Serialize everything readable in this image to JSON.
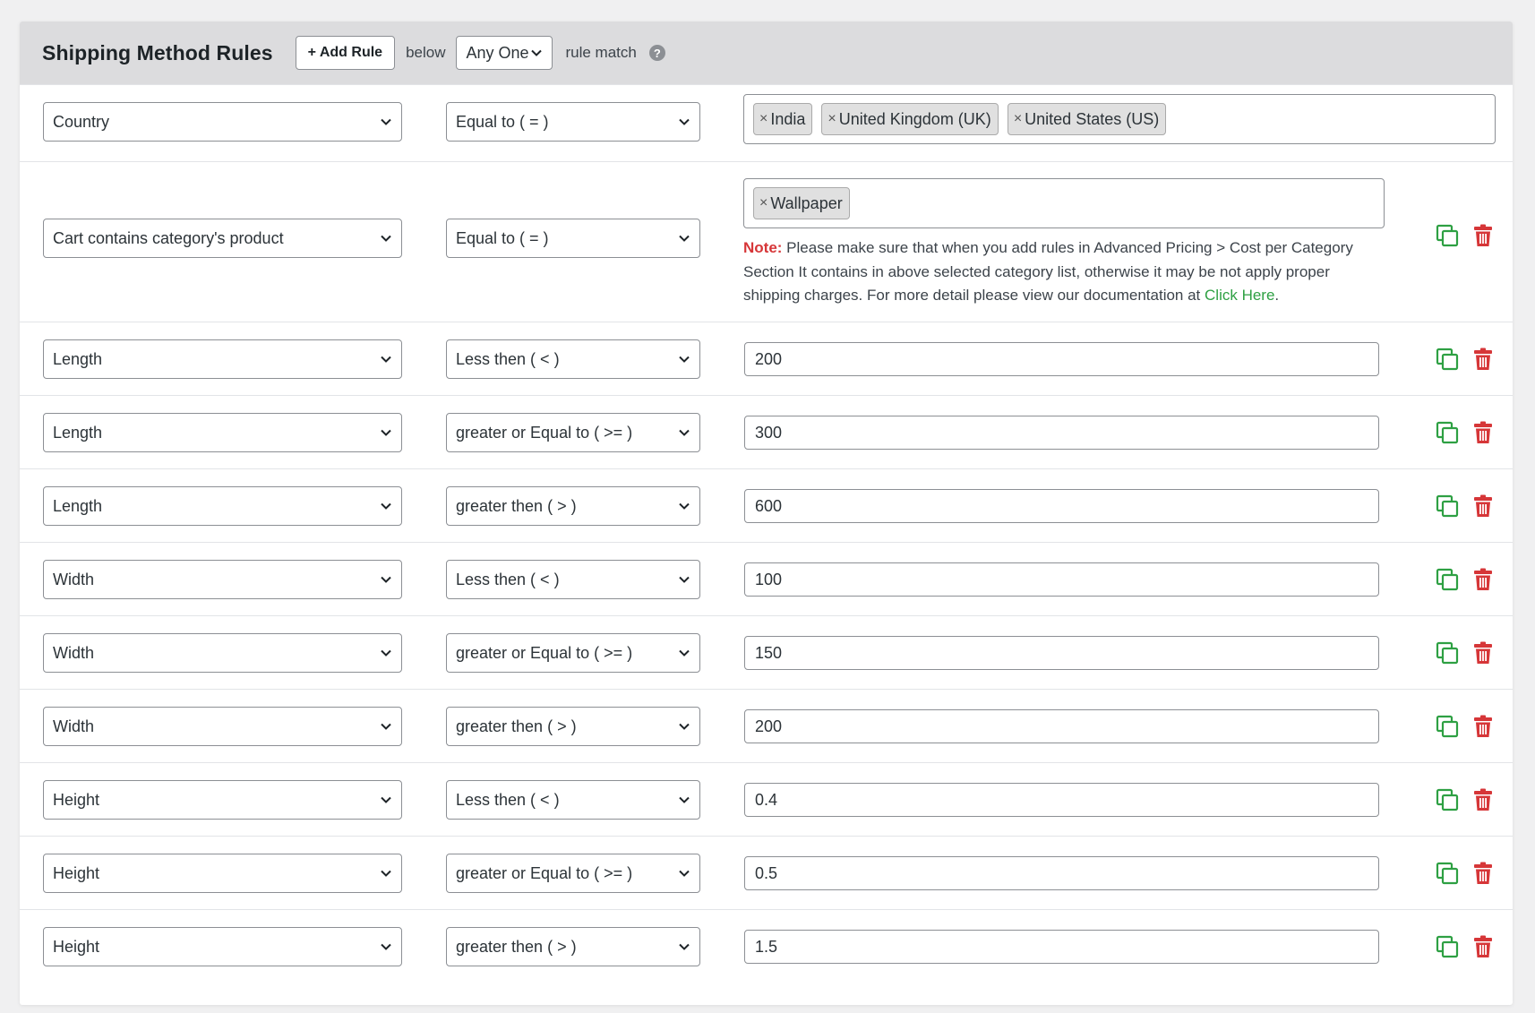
{
  "header": {
    "title": "Shipping Method Rules",
    "add_rule_label": "+ Add Rule",
    "below_text": "below",
    "match_value": "Any One",
    "rule_match_text": "rule match",
    "help_glyph": "?"
  },
  "rules": [
    {
      "field": "Country",
      "operator": "Equal to ( = )",
      "tags": [
        "India",
        "United Kingdom (UK)",
        "United States (US)"
      ]
    },
    {
      "field": "Cart contains category's product",
      "operator": "Equal to ( = )",
      "tags": [
        "Wallpaper"
      ],
      "note_label": "Note:",
      "note_text": " Please make sure that when you add rules in Advanced Pricing > Cost per Category Section It contains in above selected category list, otherwise it may be not apply proper shipping charges. For more detail please view our documentation at ",
      "note_link": "Click Here",
      "note_end": "."
    },
    {
      "field": "Length",
      "operator": "Less then ( < )",
      "value": "200"
    },
    {
      "field": "Length",
      "operator": "greater or Equal to ( >= )",
      "value": "300"
    },
    {
      "field": "Length",
      "operator": "greater then ( > )",
      "value": "600"
    },
    {
      "field": "Width",
      "operator": "Less then ( < )",
      "value": "100"
    },
    {
      "field": "Width",
      "operator": "greater or Equal to ( >= )",
      "value": "150"
    },
    {
      "field": "Width",
      "operator": "greater then ( > )",
      "value": "200"
    },
    {
      "field": "Height",
      "operator": "Less then ( < )",
      "value": "0.4"
    },
    {
      "field": "Height",
      "operator": "greater or Equal to ( >= )",
      "value": "0.5"
    },
    {
      "field": "Height",
      "operator": "greater then ( > )",
      "value": "1.5"
    }
  ],
  "icons": {
    "duplicate": "duplicate-icon",
    "delete": "trash-icon",
    "chevron": "chevron-down-icon",
    "help": "help-icon",
    "remove_tag": "remove-tag-icon"
  },
  "colors": {
    "header_bg": "#dcdcde",
    "duplicate_green": "#2ea043",
    "delete_red": "#d63638",
    "note_red": "#d63638",
    "link_green": "#2ea043"
  },
  "tag_remove_glyph": "×"
}
